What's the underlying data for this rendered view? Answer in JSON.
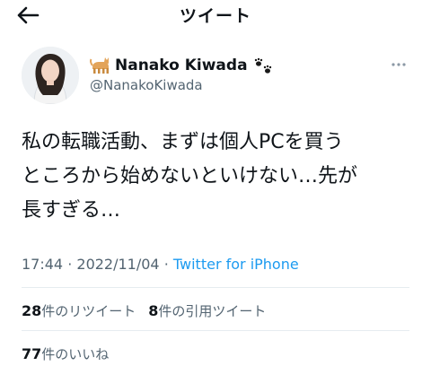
{
  "header": {
    "title": "ツイート"
  },
  "tweet": {
    "author": {
      "name": "Nanako Kiwada",
      "handle": "@NanakoKiwada"
    },
    "text": "私の転職活動、まずは個人PCを買う\nところから始めないといけない…先が\n長すぎる…",
    "time": "17:44",
    "separator": "·",
    "date": "2022/11/04",
    "source": "Twitter for iPhone"
  },
  "stats": {
    "retweets": {
      "count": "28",
      "label": "件のリツイート"
    },
    "quotes": {
      "count": "8",
      "label": "件の引用ツイート"
    },
    "likes": {
      "count": "77",
      "label": "件のいいね"
    }
  },
  "icons": [
    "back-arrow-icon",
    "cat-emoji-icon",
    "paw-prints-icon",
    "more-icon"
  ],
  "colors": {
    "link": "#1d9bf0",
    "secondary": "#536471",
    "text": "#0f1419",
    "divider": "#e6ecf0"
  }
}
